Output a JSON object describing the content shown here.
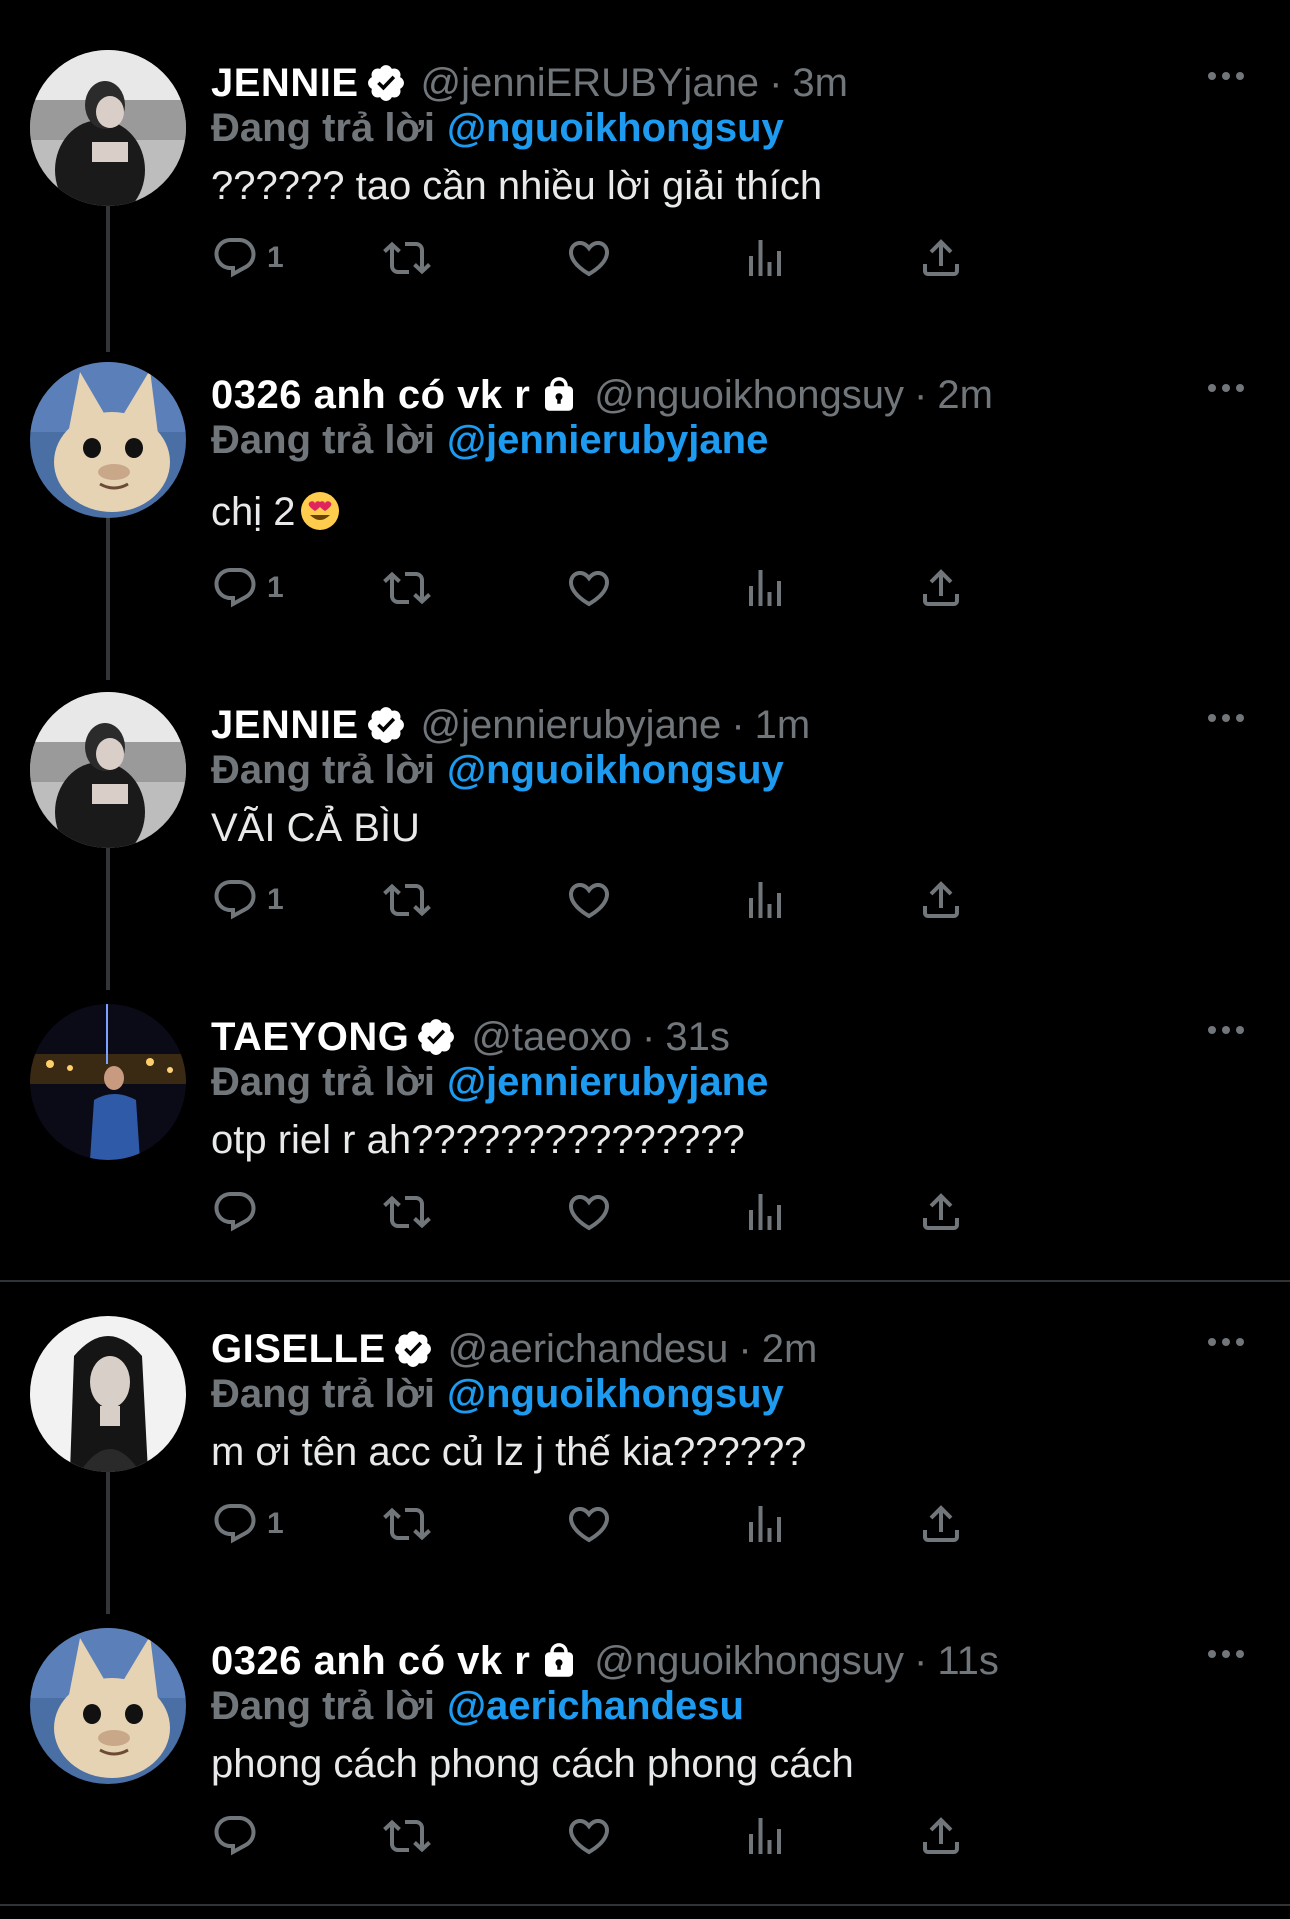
{
  "tweets": [
    {
      "name": "JENNIE",
      "verified": true,
      "locked": false,
      "handle": "@jenniERUBYjane",
      "separator": "·",
      "time": "3m",
      "reply_label": "Đang trả lời",
      "reply_to": "@nguoikhongsuy",
      "text": "?????? tao cần nhiều lời giải thích",
      "reply_count": "1",
      "avatar": "jennie-avatar"
    },
    {
      "name": "0326 anh có vk r",
      "verified": false,
      "locked": true,
      "handle": "@nguoikhongsuy",
      "separator": "·",
      "time": "2m",
      "reply_label": "Đang trả lời",
      "reply_to": "@jennierubyjane",
      "text": "chị 2",
      "emoji": "heart-eyes-emoji",
      "reply_count": "1",
      "avatar": "cat-avatar"
    },
    {
      "name": "JENNIE",
      "verified": true,
      "locked": false,
      "handle": "@jennierubyjane",
      "separator": "·",
      "time": "1m",
      "reply_label": "Đang trả lời",
      "reply_to": "@nguoikhongsuy",
      "text": "VÃI CẢ BÌU",
      "reply_count": "1",
      "avatar": "jennie-avatar"
    },
    {
      "name": "TAEYONG",
      "verified": true,
      "locked": false,
      "handle": "@taeoxo",
      "separator": "·",
      "time": "31s",
      "reply_label": "Đang trả lời",
      "reply_to": "@jennierubyjane",
      "text": "otp riel r ah???????????????",
      "reply_count": "",
      "avatar": "taeyong-avatar"
    },
    {
      "name": "GISELLE",
      "verified": true,
      "locked": false,
      "handle": "@aerichandesu",
      "separator": "·",
      "time": "2m",
      "reply_label": "Đang trả lời",
      "reply_to": "@nguoikhongsuy",
      "text": "m ơi tên acc củ lz j thế kia??????",
      "reply_count": "1",
      "avatar": "giselle-avatar"
    },
    {
      "name": "0326 anh có vk r",
      "verified": false,
      "locked": true,
      "handle": "@nguoikhongsuy",
      "separator": "·",
      "time": "11s",
      "reply_label": "Đang trả lời",
      "reply_to": "@aerichandesu",
      "text": "phong cách phong cách phong cách",
      "reply_count": "",
      "avatar": "cat-avatar"
    }
  ],
  "colors": {
    "background": "#000000",
    "secondary_text": "#71767b",
    "link": "#1d9bf0",
    "verified_badge": "#ffffff"
  }
}
